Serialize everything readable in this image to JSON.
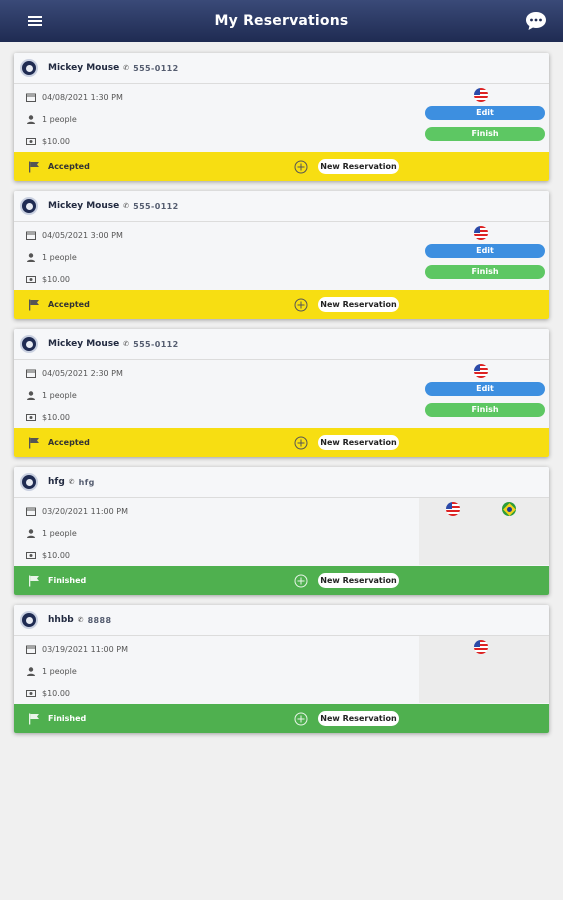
{
  "header": {
    "title": "My Reservations",
    "menu_icon": "menu-icon",
    "chat_icon": "chat-icon"
  },
  "colors": {
    "header": "#1f2b52",
    "accepted": "#f7de12",
    "finished": "#4fb04f",
    "edit": "#3d8fe0",
    "finish": "#5dc763"
  },
  "labels": {
    "edit": "Edit",
    "finish": "Finish",
    "new_reservation": "New Reservation"
  },
  "reservations": [
    {
      "name": "Mickey Mouse",
      "phone": "555-0112",
      "date": "04/08/2021 1:30 PM",
      "people": "1 people",
      "price": "$10.00",
      "status": "Accepted",
      "flags": [
        "us"
      ]
    },
    {
      "name": "Mickey Mouse",
      "phone": "555-0112",
      "date": "04/05/2021 3:00 PM",
      "people": "1 people",
      "price": "$10.00",
      "status": "Accepted",
      "flags": [
        "us"
      ]
    },
    {
      "name": "Mickey Mouse",
      "phone": "555-0112",
      "date": "04/05/2021 2:30 PM",
      "people": "1 people",
      "price": "$10.00",
      "status": "Accepted",
      "flags": [
        "us"
      ]
    },
    {
      "name": "hfg",
      "phone": "hfg",
      "date": "03/20/2021 11:00 PM",
      "people": "1 people",
      "price": "$10.00",
      "status": "Finished",
      "flags": [
        "us",
        "br"
      ]
    },
    {
      "name": "hhbb",
      "phone": "8888",
      "date": "03/19/2021 11:00 PM",
      "people": "1 people",
      "price": "$10.00",
      "status": "Finished",
      "flags": [
        "us"
      ]
    }
  ]
}
